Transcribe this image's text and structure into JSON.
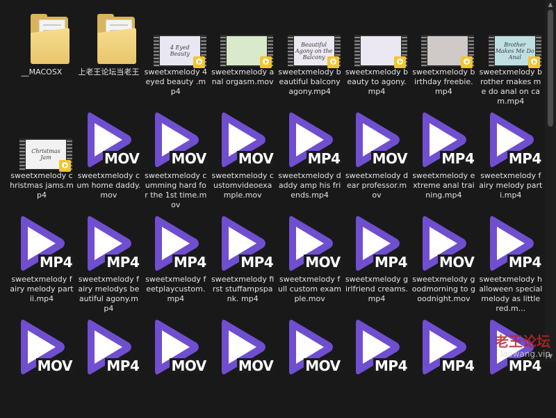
{
  "files": [
    {
      "name": "__MACOSX",
      "kind": "folder"
    },
    {
      "name": "上老王论坛当老王",
      "kind": "folder"
    },
    {
      "name": "sweetxmelody 4 eyed beauty .mp4",
      "kind": "film",
      "thumb_text": "4 Eyed Beauty",
      "bg": "#e9e7f1"
    },
    {
      "name": "sweetxmelody anal orgasm.mov",
      "kind": "film",
      "thumb_text": "",
      "bg": "#d8eac9"
    },
    {
      "name": "sweetxmelody beautiful balcony agony.mp4",
      "kind": "film",
      "thumb_text": "Beautiful Agony on the Balcony",
      "bg": "#ece9f2"
    },
    {
      "name": "sweetxmelody beauty to agony.mp4",
      "kind": "film",
      "thumb_text": "",
      "bg": "#ebe8f1"
    },
    {
      "name": "sweetxmelody birthday freebie.mp4",
      "kind": "film",
      "thumb_text": "",
      "bg": "#cfcac7"
    },
    {
      "name": "sweetxmelody brother makes me do anal on cam.mp4",
      "kind": "film",
      "thumb_text": "Brother Makes Me Do Anal",
      "bg": "#bfe0e3"
    },
    {
      "name": "sweetxmelody christmas jams.mp4",
      "kind": "film",
      "thumb_text": "Christmas Jam",
      "bg": "#f2f2f2"
    },
    {
      "name": "sweetxmelody cum home daddy.mov",
      "kind": "play",
      "ext": "MOV"
    },
    {
      "name": "sweetxmelody cumming hard for the 1st time.mov",
      "kind": "play",
      "ext": "MOV"
    },
    {
      "name": "sweetxmelody customvideoexample.mov",
      "kind": "play",
      "ext": "MOV"
    },
    {
      "name": "sweetxmelody daddy amp his friends.mp4",
      "kind": "play",
      "ext": "MP4"
    },
    {
      "name": "sweetxmelody dear professor.mov",
      "kind": "play",
      "ext": "MOV"
    },
    {
      "name": "sweetxmelody extreme anal training.mp4",
      "kind": "play",
      "ext": "MP4"
    },
    {
      "name": "sweetxmelody fairy melody part i.mp4",
      "kind": "play",
      "ext": "MP4"
    },
    {
      "name": "sweetxmelody fairy melody part ii.mp4",
      "kind": "play",
      "ext": "MP4"
    },
    {
      "name": "sweetxmelody fairy melodys beautiful agony.mp4",
      "kind": "play",
      "ext": "MP4"
    },
    {
      "name": "sweetxmelody feetplaycustom. mp4",
      "kind": "play",
      "ext": "MP4"
    },
    {
      "name": "sweetxmelody first stuffampspank. mp4",
      "kind": "play",
      "ext": "MP4"
    },
    {
      "name": "sweetxmelody full custom example.mov",
      "kind": "play",
      "ext": "MOV"
    },
    {
      "name": "sweetxmelody girlfriend creams.mp4",
      "kind": "play",
      "ext": "MP4"
    },
    {
      "name": "sweetxmelody goodmorning to goodnight.mov",
      "kind": "play",
      "ext": "MOV"
    },
    {
      "name": "sweetxmelody halloween special melody as little red.m...",
      "kind": "play",
      "ext": "MP4"
    },
    {
      "name": "",
      "kind": "play",
      "ext": "MOV"
    },
    {
      "name": "",
      "kind": "play",
      "ext": "MP4"
    },
    {
      "name": "",
      "kind": "play",
      "ext": "MOV"
    },
    {
      "name": "",
      "kind": "play",
      "ext": "MOV"
    },
    {
      "name": "",
      "kind": "play",
      "ext": "MOV"
    },
    {
      "name": "",
      "kind": "play",
      "ext": "MP4"
    },
    {
      "name": "",
      "kind": "play",
      "ext": "MP4"
    },
    {
      "name": "",
      "kind": "play",
      "ext": "MP4"
    }
  ],
  "film_badge_text": "Player",
  "scroll_up_glyph": "▲",
  "scroll_down_glyph": "▼",
  "watermark": {
    "title": "老王论坛",
    "url": "laowang.vip"
  },
  "colors": {
    "play_icon": "#6f4fd0",
    "play_icon_inner": "#ffffff",
    "folder": "#eac66c"
  }
}
